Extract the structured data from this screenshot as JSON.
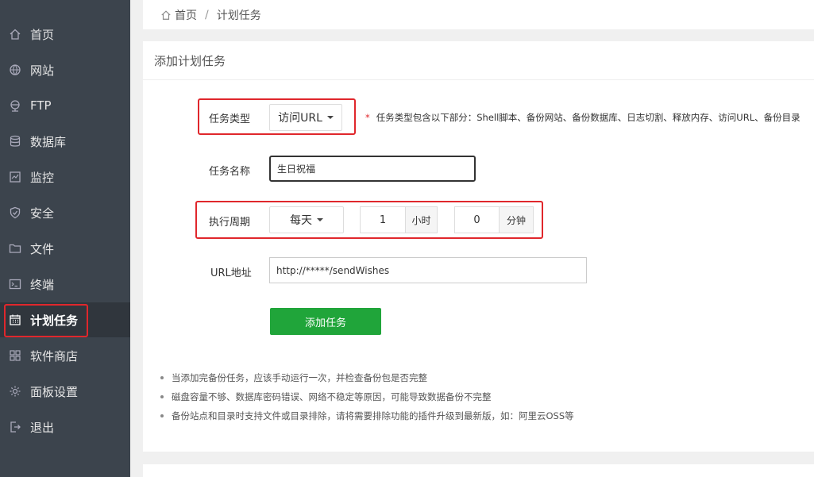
{
  "sidebar": {
    "brand": "",
    "items": [
      {
        "label": "首页",
        "icon": "home-icon"
      },
      {
        "label": "网站",
        "icon": "globe-icon"
      },
      {
        "label": "FTP",
        "icon": "ftp-icon"
      },
      {
        "label": "数据库",
        "icon": "database-icon"
      },
      {
        "label": "监控",
        "icon": "monitor-icon"
      },
      {
        "label": "安全",
        "icon": "shield-icon"
      },
      {
        "label": "文件",
        "icon": "folder-icon"
      },
      {
        "label": "终端",
        "icon": "terminal-icon"
      },
      {
        "label": "计划任务",
        "icon": "calendar-icon",
        "active": true
      },
      {
        "label": "软件商店",
        "icon": "grid-icon"
      },
      {
        "label": "面板设置",
        "icon": "gear-icon"
      },
      {
        "label": "退出",
        "icon": "logout-icon"
      }
    ]
  },
  "breadcrumb": {
    "home": "首页",
    "separator": "/",
    "current": "计划任务"
  },
  "panel": {
    "title": "添加计划任务",
    "form": {
      "task_type_label": "任务类型",
      "task_type_value": "访问URL",
      "task_type_hint_star": "*",
      "task_type_hint": "任务类型包含以下部分：Shell脚本、备份网站、备份数据库、日志切割、释放内存、访问URL、备份目录",
      "task_name_label": "任务名称",
      "task_name_value": "生日祝福",
      "cycle_label": "执行周期",
      "cycle_value": "每天",
      "hour_value": "1",
      "hour_unit": "小时",
      "minute_value": "0",
      "minute_unit": "分钟",
      "url_label": "URL地址",
      "url_value": "http://*****/sendWishes",
      "submit_label": "添加任务"
    },
    "tips": [
      "当添加完备份任务，应该手动运行一次，并检查备份包是否完整",
      "磁盘容量不够、数据库密码错误、网络不稳定等原因，可能导致数据备份不完整",
      "备份站点和目录时支持文件或目录排除，请将需要排除功能的插件升级到最新版，如：阿里云OSS等"
    ]
  },
  "colors": {
    "sidebar_bg": "#3c444d",
    "active_bg": "#30363d",
    "accent_green": "#20a53a",
    "highlight_red": "#e0272c"
  }
}
